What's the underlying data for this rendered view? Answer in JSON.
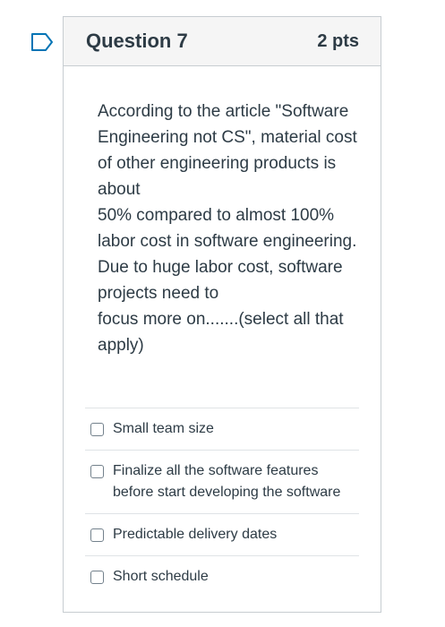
{
  "question": {
    "title": "Question 7",
    "points": "2 pts",
    "flag_icon": "bookmark-flag-icon",
    "text": {
      "line1": "According to the article \"Software Engineering not CS\", material cost of other engineering products is about",
      "line2": "50% compared to almost 100% labor cost in software engineering. Due to huge labor cost, software projects need to",
      "line3": "focus more on.......(select all that apply)"
    }
  },
  "answers": [
    {
      "label": "Small team size",
      "checked": false
    },
    {
      "label": "Finalize all the software features before start developing the software",
      "checked": false
    },
    {
      "label": "Predictable delivery dates",
      "checked": false
    },
    {
      "label": "Short schedule",
      "checked": false
    }
  ],
  "colors": {
    "header_bg": "#f5f5f5",
    "border": "#c7cdd1",
    "text": "#2d3b45",
    "flag": "#0374b5"
  }
}
